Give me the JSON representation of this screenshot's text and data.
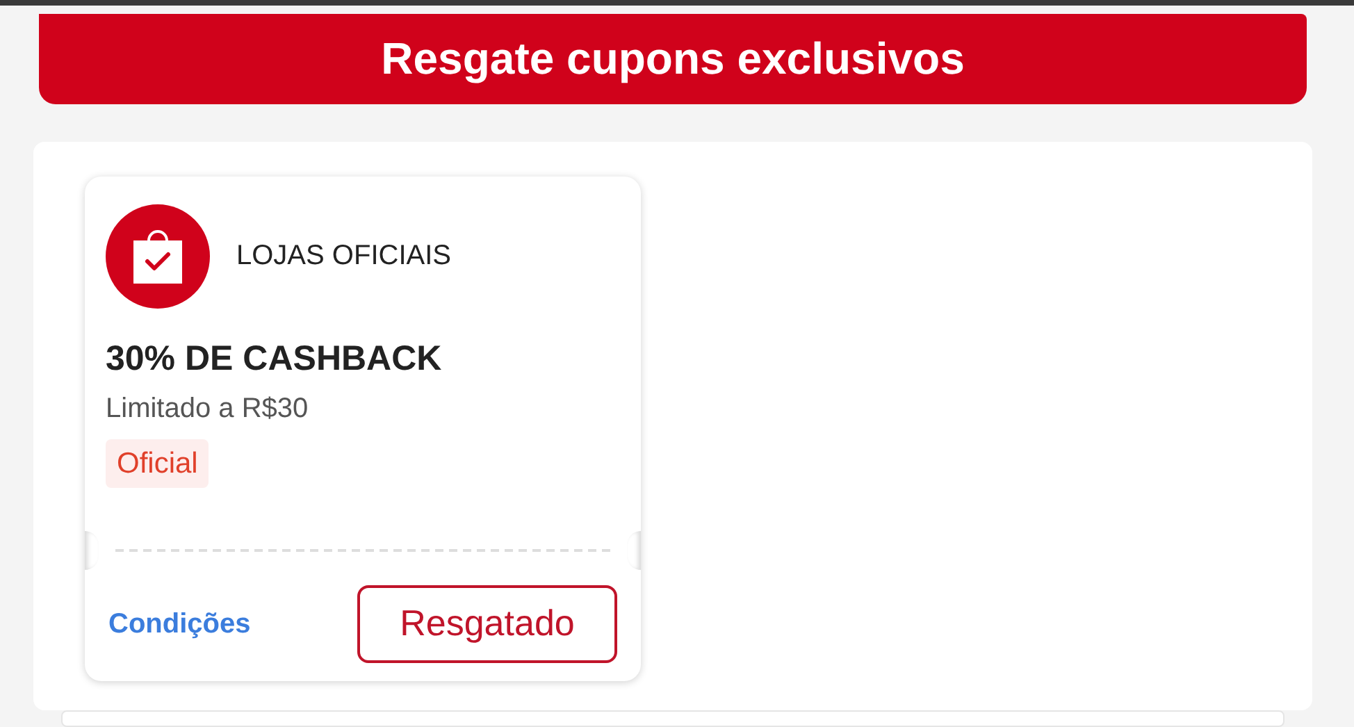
{
  "banner": {
    "title": "Resgate cupons exclusivos"
  },
  "coupons": [
    {
      "store": "LOJAS OFICIAIS",
      "title": "30% DE CASHBACK",
      "limit": "Limitado a R$30",
      "tag": "Oficial",
      "conditions_link": "Condições",
      "action": "Resgatado"
    }
  ]
}
